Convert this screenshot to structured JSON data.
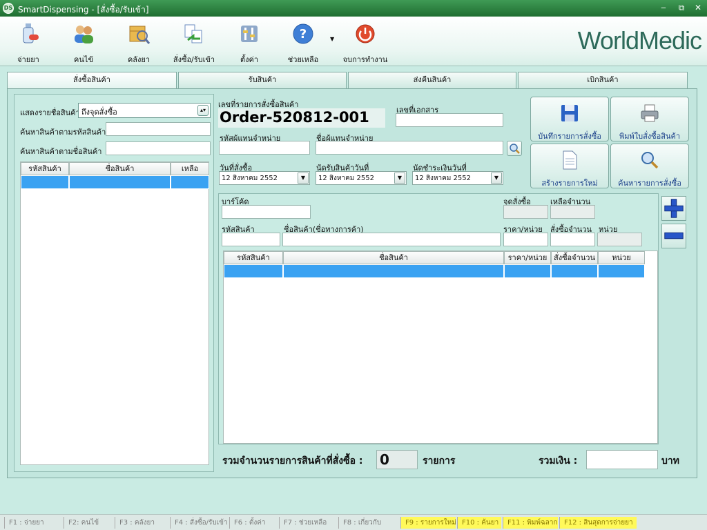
{
  "window": {
    "title": "SmartDispensing - [สั่งซื้อ/รับเข้า]",
    "icon_text": "DS"
  },
  "toolbar": {
    "items": [
      {
        "label": "จ่ายยา",
        "icon": "dispense-icon"
      },
      {
        "label": "คนไข้",
        "icon": "patients-icon"
      },
      {
        "label": "คลังยา",
        "icon": "warehouse-icon"
      },
      {
        "label": "สั่งซื้อ/รับเข้า",
        "icon": "order-receive-icon"
      },
      {
        "label": "ตั้งค่า",
        "icon": "settings-icon"
      },
      {
        "label": "ช่วยเหลือ",
        "icon": "help-icon"
      },
      {
        "label": "จบการทำงาน",
        "icon": "power-icon"
      }
    ],
    "brand": "WorldMedic"
  },
  "tabs": [
    "สั่งซื้อสินค้า",
    "รับสินค้า",
    "ส่งคืนสินค้า",
    "เบิกสินค้า"
  ],
  "left": {
    "show_label": "แสดงรายชื่อสินค้า",
    "show_value": "ถึงจุดสั่งซื้อ",
    "search_code_label": "ค้นหาสินค้าตามรหัสสินค้า",
    "search_name_label": "ค้นหาสินค้าตามชื่อสินค้า",
    "search_code_value": "",
    "search_name_value": "",
    "columns": [
      "รหัสสินค้า",
      "ชื่อสินค้า",
      "เหลือ"
    ]
  },
  "order": {
    "number_label": "เลขที่รายการสั่งซื้อสินค้า",
    "number": "Order-520812-001",
    "doc_label": "เลขที่เอกสาร",
    "doc_value": "",
    "agent_code_label": "รหัสผู้แทนจำหน่าย",
    "agent_code_value": "",
    "agent_name_label": "ชื่อผู้แทนจำหน่าย",
    "agent_name_value": "",
    "order_date_label": "วันที่สั่งซื้อ",
    "receive_date_label": "นัดรับสินค้าวันที่",
    "payment_date_label": "นัดชำระเงินวันที่",
    "order_date": "12   สิงหาคม     2552",
    "receive_date": "12   สิงหาคม     2552",
    "payment_date": "12   สิงหาคม     2552"
  },
  "actions": {
    "save": "บันทึกรายการสั่งซื้อ",
    "print": "พิมพ์ใบสั่งซื้อสินค้า",
    "new": "สร้างรายการใหม่",
    "search": "ค้นหารายการสั่งซื้อ"
  },
  "item": {
    "barcode_label": "บาร์โค้ด",
    "reorder_label": "จุดสั่งซื้อ",
    "remaining_label": "เหลือจำนวน",
    "code_label": "รหัสสินค้า",
    "name_label": "ชื่อสินค้า(ชื่อทางการค้า)",
    "price_label": "ราคา/หน่วย",
    "qty_label": "สั่งซื้อจำนวน",
    "unit_label": "หน่วย",
    "columns": [
      "รหัสสินค้า",
      "ชื่อสินค้า",
      "ราคา/หน่วย",
      "สั่งซื้อจำนวน",
      "หน่วย"
    ]
  },
  "totals": {
    "count_label": "รวมจำนวนรายการสินค้าที่สั่งซื้อ :",
    "count_value": "0",
    "count_unit": "รายการ",
    "sum_label": "รวมเงิน :",
    "sum_value": "",
    "sum_unit": "บาท"
  },
  "statusbar": [
    {
      "label": "F1 : จ่ายยา",
      "highlight": false
    },
    {
      "label": "F2: คนไข้",
      "highlight": false
    },
    {
      "label": "F3 : คลังยา",
      "highlight": false
    },
    {
      "label": "F4 : สั่งซื้อ/รับเข้า",
      "highlight": false
    },
    {
      "label": "F6 : ตั้งค่า",
      "highlight": false
    },
    {
      "label": "F7 : ช่วยเหลือ",
      "highlight": false
    },
    {
      "label": "F8 : เกี่ยวกับ",
      "highlight": false
    },
    {
      "label": "F9 : รายการใหม่",
      "highlight": true
    },
    {
      "label": "F10 : ค้นยา",
      "highlight": true
    },
    {
      "label": "F11 : พิมพ์ฉลาก",
      "highlight": true
    },
    {
      "label": "F12 : สินสุดการจ่ายยา",
      "highlight": true
    }
  ],
  "colors": {
    "accent": "#3aa2f2",
    "panel": "#c9ebe3",
    "titlebar": "#2a7f3f",
    "fkey_highlight": "#fff95a"
  }
}
